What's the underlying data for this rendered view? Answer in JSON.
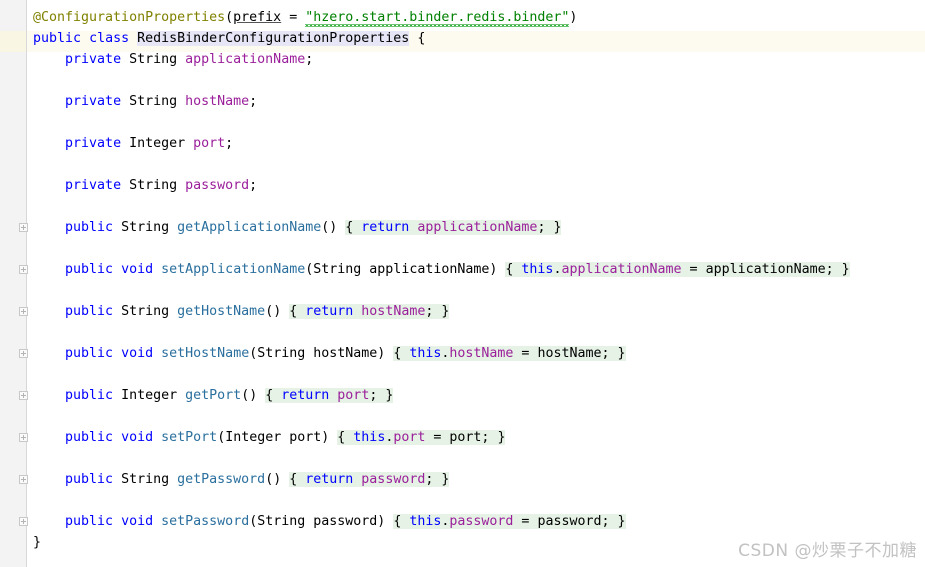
{
  "editor": {
    "language": "java",
    "background_color": "#ffffff",
    "gutter_color": "#f3f3f3",
    "caret_line_color": "#fdfaef",
    "identifier_highlight_color": "#e6e6f7",
    "method_body_highlight_color": "#e5f2e5"
  },
  "watermark": {
    "text": "CSDN @炒栗子不加糖",
    "color": "#c2c2c2"
  },
  "code": {
    "annotation_name": "@ConfigurationProperties",
    "annotation_param": "prefix",
    "annotation_value": "\"hzero.start.binder.redis.binder\"",
    "class_name": "RedisBinderConfigurationProperties",
    "closing_brace": "}",
    "tokens": {
      "public": "public",
      "private": "private",
      "class": "class",
      "void": "void",
      "return": "return",
      "this": "this",
      "type_string": "String",
      "type_integer": "Integer",
      "open_brace": "{",
      "close_brace": "}",
      "equals": "=",
      "semicolon": ";",
      "open_paren": "(",
      "close_paren": ")",
      "dot": "."
    },
    "fields": [
      {
        "modifier": "private",
        "type": "String",
        "name": "applicationName"
      },
      {
        "modifier": "private",
        "type": "String",
        "name": "hostName"
      },
      {
        "modifier": "private",
        "type": "Integer",
        "name": "port"
      },
      {
        "modifier": "private",
        "type": "String",
        "name": "password"
      }
    ],
    "getters": [
      {
        "type": "String",
        "name": "getApplicationName",
        "field": "applicationName"
      },
      {
        "type": "String",
        "name": "getHostName",
        "field": "hostName"
      },
      {
        "type": "Integer",
        "name": "getPort",
        "field": "port"
      },
      {
        "type": "String",
        "name": "getPassword",
        "field": "password"
      }
    ],
    "setters": [
      {
        "name": "setApplicationName",
        "param_type": "String",
        "param": "applicationName",
        "field": "applicationName"
      },
      {
        "name": "setHostName",
        "param_type": "String",
        "param": "hostName",
        "field": "hostName"
      },
      {
        "name": "setPort",
        "param_type": "Integer",
        "param": "port",
        "field": "port"
      },
      {
        "name": "setPassword",
        "param_type": "String",
        "param": "password",
        "field": "password"
      }
    ],
    "lines": [
      {
        "n": 1,
        "kind": "annotation"
      },
      {
        "n": 2,
        "kind": "class-decl"
      },
      {
        "n": 3,
        "kind": "field",
        "index": 0
      },
      {
        "n": 4,
        "kind": "blank"
      },
      {
        "n": 5,
        "kind": "field",
        "index": 1
      },
      {
        "n": 6,
        "kind": "blank"
      },
      {
        "n": 7,
        "kind": "field",
        "index": 2
      },
      {
        "n": 8,
        "kind": "blank"
      },
      {
        "n": 9,
        "kind": "field",
        "index": 3
      },
      {
        "n": 10,
        "kind": "blank"
      },
      {
        "n": 11,
        "kind": "getter",
        "index": 0
      },
      {
        "n": 12,
        "kind": "blank"
      },
      {
        "n": 13,
        "kind": "setter",
        "index": 0
      },
      {
        "n": 14,
        "kind": "blank"
      },
      {
        "n": 15,
        "kind": "getter",
        "index": 1
      },
      {
        "n": 16,
        "kind": "blank"
      },
      {
        "n": 17,
        "kind": "setter",
        "index": 1
      },
      {
        "n": 18,
        "kind": "blank"
      },
      {
        "n": 19,
        "kind": "getter",
        "index": 2
      },
      {
        "n": 20,
        "kind": "blank"
      },
      {
        "n": 21,
        "kind": "setter",
        "index": 2
      },
      {
        "n": 22,
        "kind": "blank"
      },
      {
        "n": 23,
        "kind": "getter",
        "index": 3
      },
      {
        "n": 24,
        "kind": "blank"
      },
      {
        "n": 25,
        "kind": "setter",
        "index": 3
      },
      {
        "n": 26,
        "kind": "class-close"
      }
    ],
    "fold_marker_lines": [
      11,
      13,
      15,
      17,
      19,
      21,
      23,
      25
    ],
    "caret_line": 2,
    "warning_underline_text": "hzero.start.binde"
  }
}
